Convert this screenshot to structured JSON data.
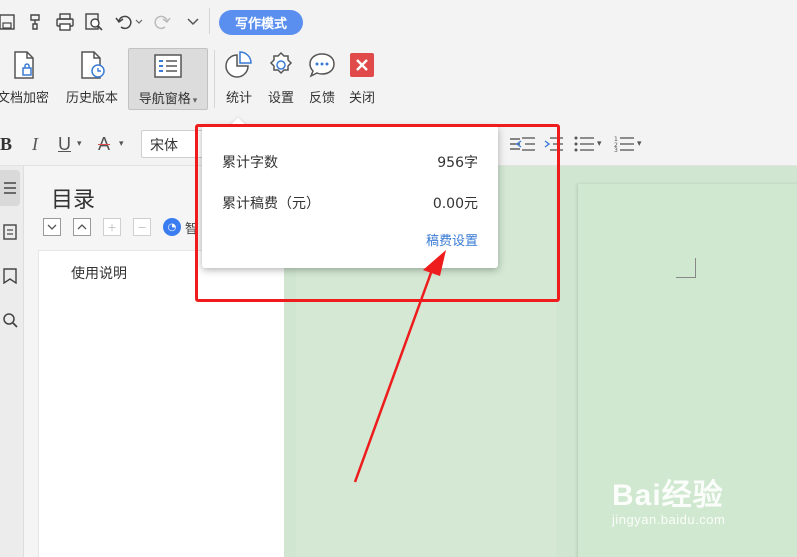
{
  "toolbar": {
    "mode_label": "写作模式"
  },
  "ribbon": {
    "buttons": [
      {
        "label": "文档加密",
        "icon": "document-lock-icon"
      },
      {
        "label": "历史版本",
        "icon": "document-history-icon"
      },
      {
        "label": "导航窗格",
        "icon": "navigation-pane-icon",
        "active": true
      },
      {
        "label": "统计",
        "icon": "pie-chart-icon"
      },
      {
        "label": "设置",
        "icon": "gear-icon"
      },
      {
        "label": "反馈",
        "icon": "chat-bubble-icon"
      },
      {
        "label": "关闭",
        "icon": "close-icon"
      }
    ]
  },
  "format": {
    "bold": "B",
    "italic": "I",
    "underline": "U",
    "fontcolor": "A",
    "font_name": "宋体"
  },
  "nav": {
    "title": "目录",
    "smart_label": "智",
    "items": [
      "使用说明"
    ]
  },
  "popup": {
    "rows": [
      {
        "label": "累计字数",
        "value": "956字"
      },
      {
        "label": "累计稿费（元）",
        "value": "0.00元"
      }
    ],
    "link": "稿费设置"
  },
  "watermark": {
    "main": "Bai经验",
    "sub": "jingyan.baidu.com"
  },
  "colors": {
    "accent": "#5a8ff0",
    "highlight": "#ee1c1c",
    "doc_bg": "#d0e6d0",
    "close_red": "#e04a4a"
  }
}
